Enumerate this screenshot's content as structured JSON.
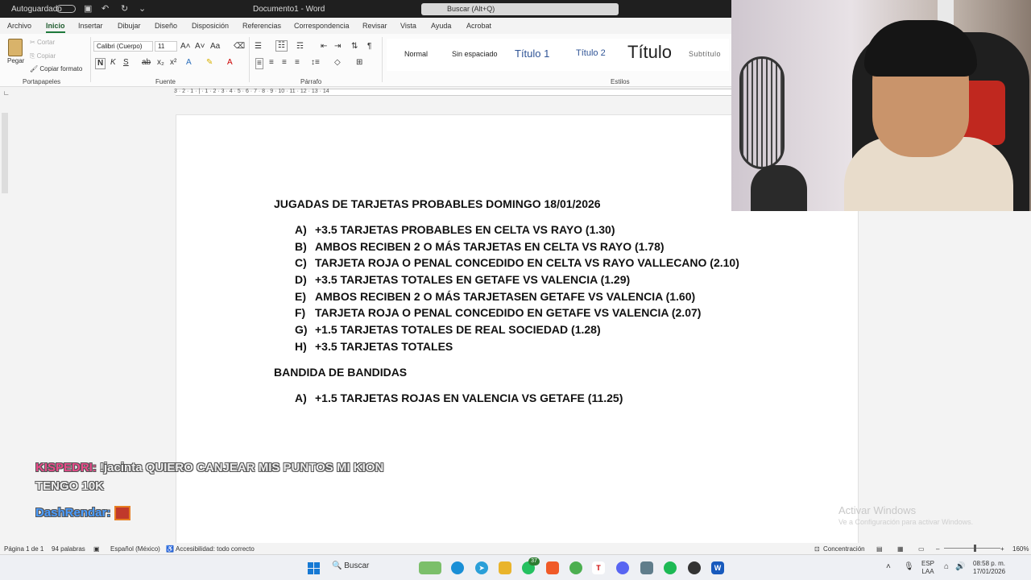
{
  "titlebar": {
    "autosave_label": "Autoguardado",
    "doc_title": "Documento1 - Word",
    "search_placeholder": "Buscar (Alt+Q)"
  },
  "tabs": [
    "Archivo",
    "Inicio",
    "Insertar",
    "Dibujar",
    "Diseño",
    "Disposición",
    "Referencias",
    "Correspondencia",
    "Revisar",
    "Vista",
    "Ayuda",
    "Acrobat"
  ],
  "active_tab": "Inicio",
  "ribbon": {
    "clipboard": {
      "paste": "Pegar",
      "cut": "Cortar",
      "copy": "Copiar",
      "format_painter": "Copiar formato",
      "group": "Portapapeles"
    },
    "font": {
      "font_name": "Calibri (Cuerpo)",
      "font_size": "11",
      "group": "Fuente",
      "bold": "N",
      "italic": "K",
      "underline": "S"
    },
    "paragraph": {
      "group": "Párrafo"
    },
    "styles": {
      "group": "Estilos",
      "items": [
        "Normal",
        "Sin espaciado",
        "Título 1",
        "Título 2",
        "Título",
        "Subtítulo"
      ]
    }
  },
  "ruler_numbers": "3 · 2 · 1 · | · 1 · 2 · 3 · 4 · 5 · 6 · 7 · 8 · 9 · 10 · 11 · 12 · 13 · 14",
  "document": {
    "heading1": "JUGADAS DE TARJETAS PROBABLES DOMINGO 18/01/2026",
    "list1": [
      {
        "letter": "A)",
        "text": "+3.5 TARJETAS PROBABLES EN CELTA VS RAYO (1.30)"
      },
      {
        "letter": "B)",
        "text": "AMBOS RECIBEN 2 O MÁS TARJETAS EN CELTA VS RAYO (1.78)"
      },
      {
        "letter": "C)",
        "text": "TARJETA ROJA O PENAL CONCEDIDO EN CELTA VS RAYO VALLECANO (2.10)"
      },
      {
        "letter": "D)",
        "text": "+3.5 TARJETAS TOTALES EN GETAFE VS VALENCIA (1.29)"
      },
      {
        "letter": "E)",
        "text": "AMBOS RECIBEN 2 O MÁS TARJETASEN GETAFE VS VALENCIA (1.60)"
      },
      {
        "letter": "F)",
        "text": "TARJETA ROJA O PENAL CONCEDIDO EN GETAFE VS VALENCIA (2.07)"
      },
      {
        "letter": "G)",
        "text": "+1.5 TARJETAS TOTALES DE REAL SOCIEDAD (1.28)"
      },
      {
        "letter": "H)",
        "text": "+3.5 TARJETAS TOTALES"
      }
    ],
    "heading2": "BANDIDA DE BANDIDAS",
    "list2": [
      {
        "letter": "A)",
        "text": "+1.5 TARJETAS ROJAS EN VALENCIA VS GETAFE (11.25)"
      }
    ]
  },
  "chat": [
    {
      "user": "KISPEDRI:",
      "message": "!jacinta QUIERO CANJEAR MIS PUNTOS MI KION",
      "message2": "TENGO 10K"
    },
    {
      "user": "DashRendar:",
      "message": ""
    }
  ],
  "watermark": {
    "line1": "Activar Windows",
    "line2": "Ve a Configuración para activar Windows."
  },
  "statusbar": {
    "page": "Página 1 de 1",
    "words": "94 palabras",
    "language": "Español (México)",
    "accessibility": "Accesibilidad: todo correcto",
    "focus": "Concentración",
    "zoom": "160%"
  },
  "taskbar": {
    "search": "Buscar",
    "badge": "37",
    "lang1": "ESP",
    "lang2": "LAA",
    "time": "08:58 p. m.",
    "date": "17/01/2026"
  },
  "colors": {
    "accent": "#1e7a3c",
    "chat_user1": "#e84b8a",
    "chat_user2": "#4a9cff"
  }
}
